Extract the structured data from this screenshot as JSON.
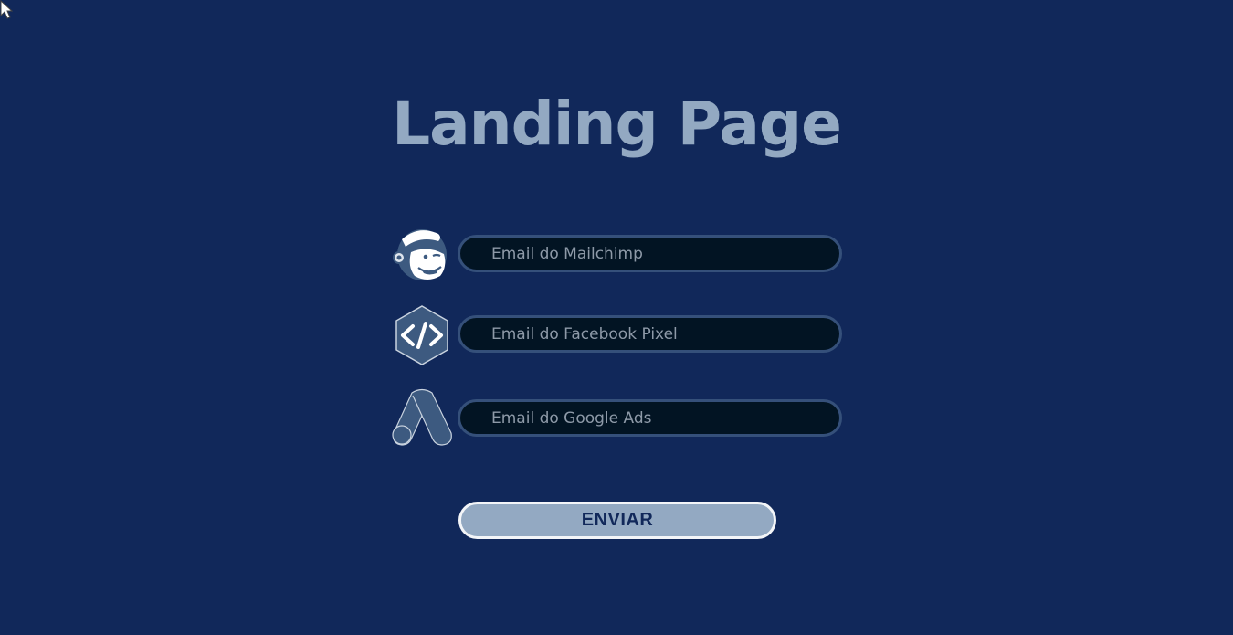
{
  "page": {
    "title": "Landing Page"
  },
  "form": {
    "fields": [
      {
        "icon": "mailchimp-icon",
        "placeholder": "Email do Mailchimp",
        "value": ""
      },
      {
        "icon": "code-icon",
        "placeholder": "Email do Facebook Pixel",
        "value": ""
      },
      {
        "icon": "google-ads-icon",
        "placeholder": "Email do Google Ads",
        "value": ""
      }
    ],
    "submit_label": "ENVIAR"
  },
  "colors": {
    "background": "#11285a",
    "accent": "#93a9c2",
    "input_background": "#021423",
    "input_border": "#35507a",
    "icon_fill": "#3d5a80"
  }
}
